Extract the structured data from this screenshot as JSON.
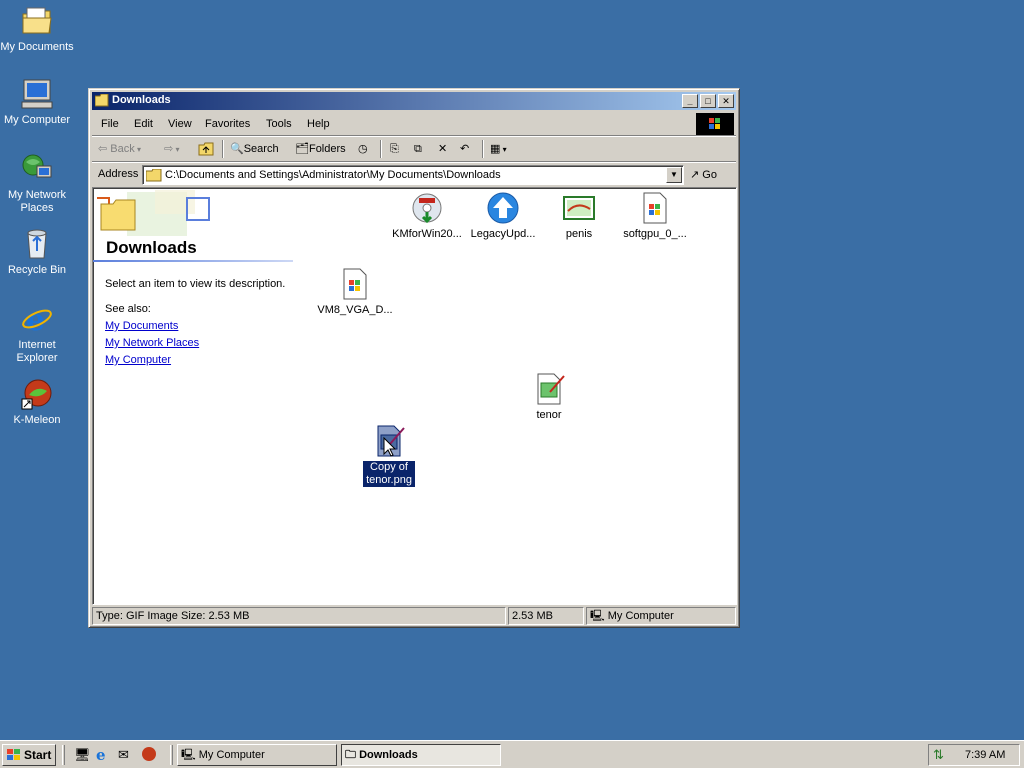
{
  "desktop": {
    "icons": [
      {
        "label": "My Documents",
        "icon": "my-documents-icon"
      },
      {
        "label": "My Computer",
        "icon": "my-computer-icon"
      },
      {
        "label": "My Network Places",
        "icon": "network-places-icon"
      },
      {
        "label": "Recycle Bin",
        "icon": "recycle-bin-icon"
      },
      {
        "label": "Internet Explorer",
        "icon": "internet-explorer-icon"
      },
      {
        "label": "K-Meleon",
        "icon": "k-meleon-icon"
      }
    ]
  },
  "window": {
    "title": "Downloads",
    "controls": {
      "minimize": "_",
      "maximize": "□",
      "close": "✕"
    },
    "menu": [
      "File",
      "Edit",
      "View",
      "Favorites",
      "Tools",
      "Help"
    ],
    "toolbar": {
      "back": "Back",
      "search": "Search",
      "folders": "Folders"
    },
    "address": {
      "label": "Address",
      "value": "C:\\Documents and Settings\\Administrator\\My Documents\\Downloads",
      "go": "Go"
    },
    "left_pane": {
      "title": "Downloads",
      "description": "Select an item to view its description.",
      "see_also": "See also:",
      "links": [
        "My Documents",
        "My Network Places",
        "My Computer"
      ]
    },
    "files": [
      {
        "label": "KMforWin20...",
        "icon": "installer-disc-icon"
      },
      {
        "label": "LegacyUpd...",
        "icon": "legacy-update-icon"
      },
      {
        "label": "penis",
        "icon": "image-file-icon"
      },
      {
        "label": "softgpu_0_...",
        "icon": "setup-file-icon"
      },
      {
        "label": "VM8_VGA_D...",
        "icon": "setup-file-icon"
      },
      {
        "label": "tenor",
        "icon": "gif-image-icon"
      },
      {
        "label": "Copy of tenor.png",
        "icon": "png-image-icon",
        "selected": true
      }
    ],
    "status": {
      "info": "Type: GIF Image Size: 2.53 MB",
      "size": "2.53 MB",
      "zone": "My Computer"
    }
  },
  "taskbar": {
    "start": "Start",
    "tasks": [
      {
        "label": "My Computer",
        "active": false
      },
      {
        "label": "Downloads",
        "active": true
      }
    ],
    "clock": "7:39 AM"
  },
  "colors": {
    "desktop": "#3a6ea5",
    "title_active_start": "#0a246a",
    "title_active_end": "#a6caf0",
    "face": "#d4d0c8",
    "selection": "#0a246a",
    "link": "#0000cc"
  }
}
